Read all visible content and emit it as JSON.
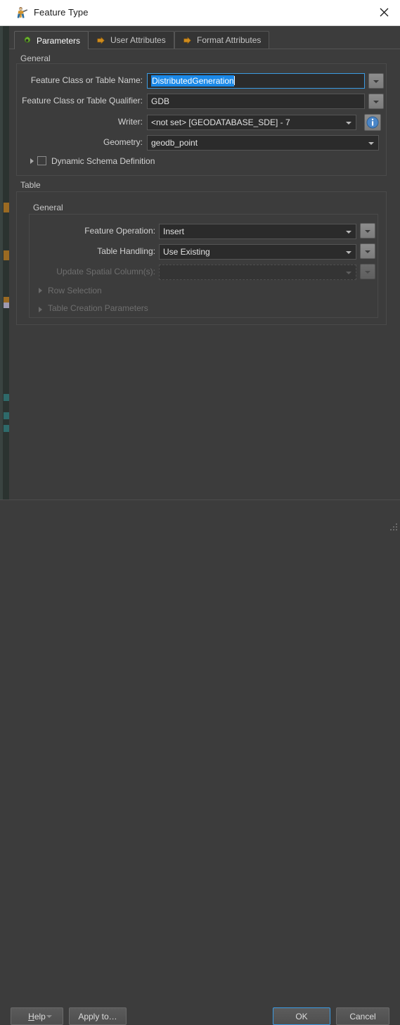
{
  "window": {
    "title": "Feature Type",
    "icon": "fme-feature-type-icon",
    "close_label": "×"
  },
  "tabs": [
    {
      "label": "Parameters",
      "icon": "green-gear-icon",
      "active": true
    },
    {
      "label": "User Attributes",
      "icon": "orange-arrow-icon",
      "active": false
    },
    {
      "label": "Format Attributes",
      "icon": "orange-arrow-icon",
      "active": false
    }
  ],
  "general_group": {
    "legend": "General",
    "rows": [
      {
        "label": "Feature Class or Table Name:",
        "value": "DistributedGeneration",
        "state": "focused-selected",
        "has_side_button": true
      },
      {
        "label": "Feature Class or Table Qualifier:",
        "value": "GDB",
        "state": "normal",
        "has_side_button": true
      },
      {
        "label": "Writer:",
        "value": "<not set> [GEODATABASE_SDE] - 7",
        "state": "combo",
        "has_info_button": true
      },
      {
        "label": "Geometry:",
        "value": "geodb_point",
        "state": "combo"
      }
    ],
    "dynamic_schema": {
      "label": "Dynamic Schema Definition",
      "checked": false,
      "expanded": false
    }
  },
  "table_group": {
    "legend": "Table",
    "inner_legend": "General",
    "rows": [
      {
        "label": "Feature Operation:",
        "value": "Insert",
        "state": "combo",
        "disabled": false
      },
      {
        "label": "Table Handling:",
        "value": "Use Existing",
        "state": "combo",
        "disabled": false
      },
      {
        "label": "Update Spatial Column(s):",
        "value": "",
        "state": "combo",
        "disabled": true
      }
    ],
    "expanders": [
      {
        "label": "Row Selection",
        "expanded": false,
        "disabled": true
      },
      {
        "label": "Table Creation Parameters",
        "expanded": false,
        "disabled": true
      }
    ]
  },
  "footer": {
    "help": "Help",
    "help_mnemonic": "H",
    "help_rest": "elp",
    "apply_to": "Apply to…",
    "ok": "OK",
    "cancel": "Cancel"
  },
  "colors": {
    "dialog_bg": "#3c3c3c",
    "field_bg": "#2b2b2b",
    "accent_focus": "#3b9ae1",
    "selection_blue": "#1b89e8",
    "titlebar_bg": "#ffffff",
    "tab_icon_green": "#5aa02c",
    "tab_icon_orange": "#c8861e"
  }
}
